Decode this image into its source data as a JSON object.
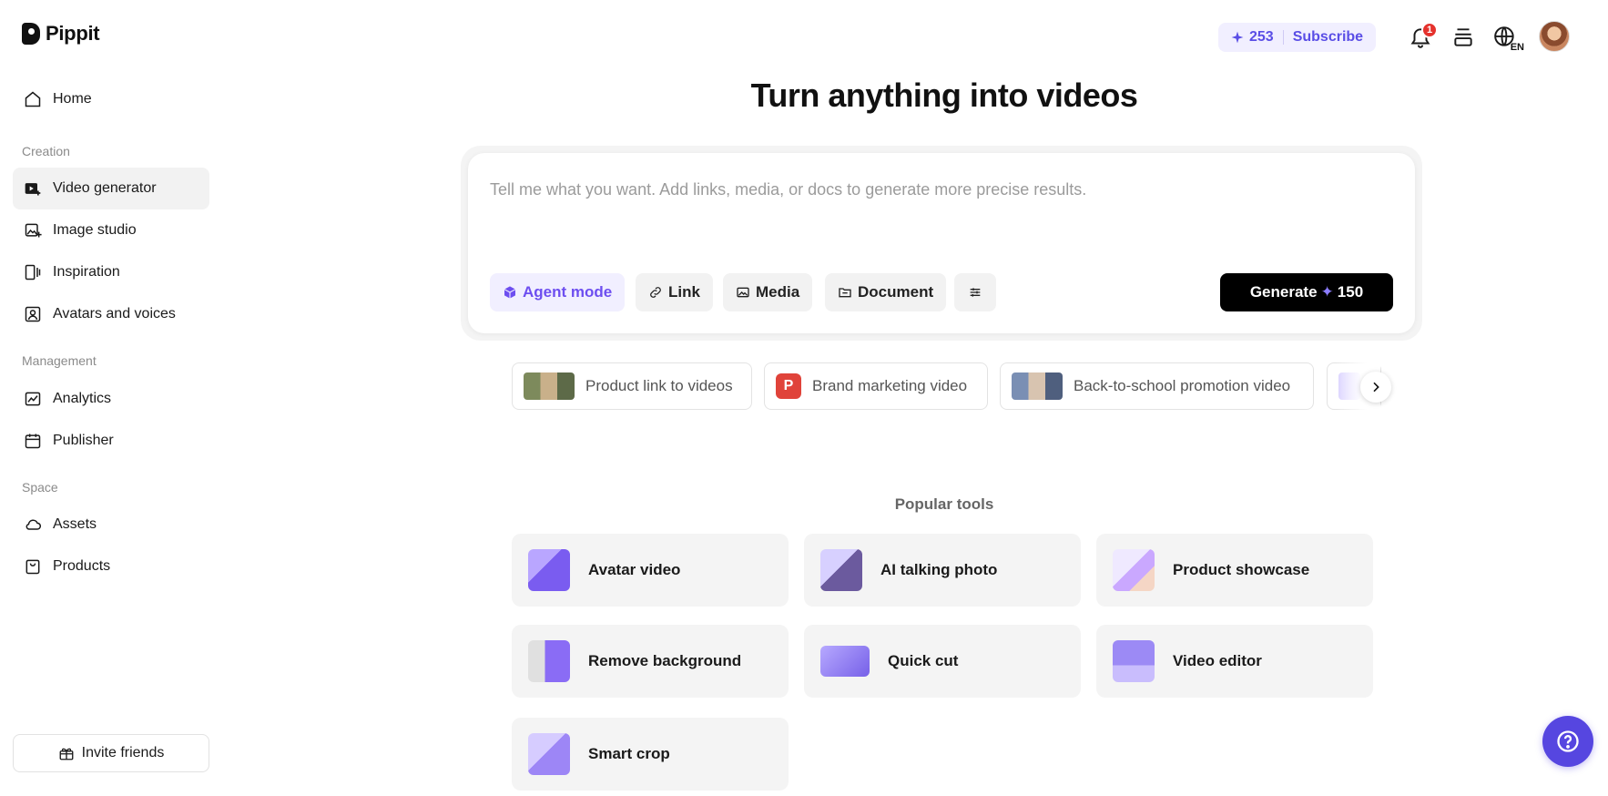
{
  "app": {
    "name": "Pippit"
  },
  "sidebar": {
    "home": "Home",
    "sections": {
      "creation": "Creation",
      "management": "Management",
      "space": "Space"
    },
    "items": {
      "video_generator": "Video generator",
      "image_studio": "Image studio",
      "inspiration": "Inspiration",
      "avatars_voices": "Avatars and voices",
      "analytics": "Analytics",
      "publisher": "Publisher",
      "assets": "Assets",
      "products": "Products"
    },
    "active": "video_generator",
    "invite": "Invite friends"
  },
  "topbar": {
    "credits": "253",
    "subscribe": "Subscribe",
    "notification_count": "1",
    "language": "EN"
  },
  "main": {
    "title": "Turn anything into videos",
    "prompt_placeholder": "Tell me what you want. Add links, media, or docs to generate more precise results.",
    "chips": {
      "agent": "Agent mode",
      "link": "Link",
      "media": "Media",
      "document": "Document"
    },
    "generate": {
      "label": "Generate",
      "cost": "150"
    },
    "suggestions": [
      "Product link to videos",
      "Brand marketing video",
      "Back-to-school promotion video"
    ],
    "brand_icon_letter": "P",
    "popular_title": "Popular tools",
    "tools": [
      "Avatar video",
      "AI talking photo",
      "Product showcase",
      "Remove background",
      "Quick cut",
      "Video editor",
      "Smart crop"
    ]
  },
  "colors": {
    "accent": "#5a4ee6",
    "agent_chip": "#6d4ef0",
    "badge": "#e5322d",
    "help_button": "#5646e0"
  },
  "icons": {
    "home": "home-icon",
    "video_generator": "video-plus-icon",
    "image_studio": "image-plus-icon",
    "inspiration": "inspiration-icon",
    "avatars_voices": "avatar-icon",
    "analytics": "chart-icon",
    "publisher": "calendar-icon",
    "assets": "cloud-icon",
    "products": "bag-icon",
    "invite": "gift-icon",
    "notifications": "bell-icon",
    "inbox": "layers-icon",
    "language": "globe-icon",
    "help": "question-icon"
  }
}
